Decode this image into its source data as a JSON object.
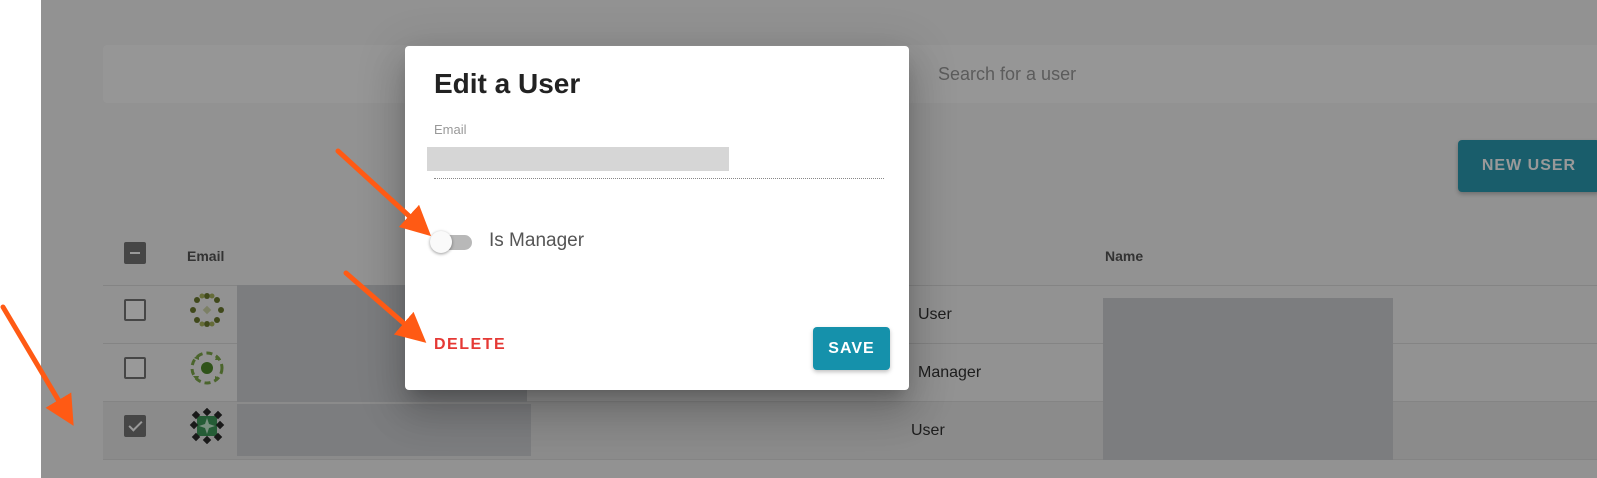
{
  "background": {
    "search_placeholder": "Search for a user",
    "new_user_label": "NEW USER",
    "table": {
      "headers": {
        "email": "Email",
        "name": "Name"
      },
      "rows": [
        {
          "role": "User",
          "checked": false
        },
        {
          "role": "Manager",
          "checked": false
        },
        {
          "role": "User",
          "checked": true
        }
      ]
    }
  },
  "dialog": {
    "title": "Edit a User",
    "email_label": "Email",
    "is_manager_label": "Is Manager",
    "is_manager_on": false,
    "delete_label": "DELETE",
    "save_label": "SAVE"
  },
  "colors": {
    "accent": "#1591ab",
    "delete": "#e53935",
    "annotation_arrow": "#ff5a14"
  }
}
